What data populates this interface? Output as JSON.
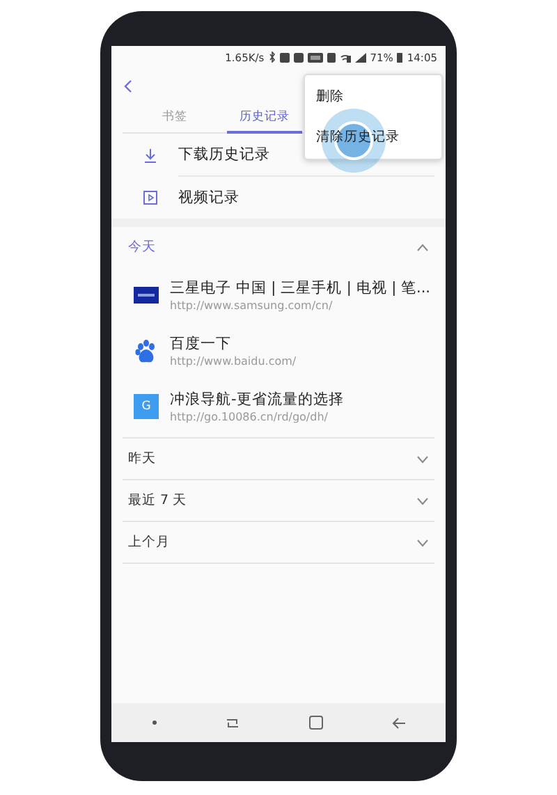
{
  "status_bar": {
    "speed": "1.65K/s",
    "battery": "71%",
    "time": "14:05"
  },
  "tabs": [
    {
      "label": "书签",
      "selected": false
    },
    {
      "label": "历史记录",
      "selected": true
    }
  ],
  "shortcuts": [
    {
      "kind": "download",
      "label": "下载历史记录"
    },
    {
      "kind": "video",
      "label": "视频记录"
    }
  ],
  "sections": [
    {
      "title": "今天",
      "expanded": true,
      "entries": [
        {
          "kind": "samsung",
          "title": "三星电子 中国 | 三星手机 | 电视 | 笔...",
          "url": "http://www.samsung.com/cn/"
        },
        {
          "kind": "paw",
          "title": "百度一下",
          "url": "http://www.baidu.com/"
        },
        {
          "kind": "letter",
          "letter": "G",
          "title": "冲浪导航-更省流量的选择",
          "url": "http://go.10086.cn/rd/go/dh/"
        }
      ]
    },
    {
      "title": "昨天",
      "expanded": false
    },
    {
      "title": "最近 7 天",
      "expanded": false
    },
    {
      "title": "上个月",
      "expanded": false
    }
  ],
  "menu": {
    "items": [
      "删除",
      "清除历史记录"
    ]
  }
}
